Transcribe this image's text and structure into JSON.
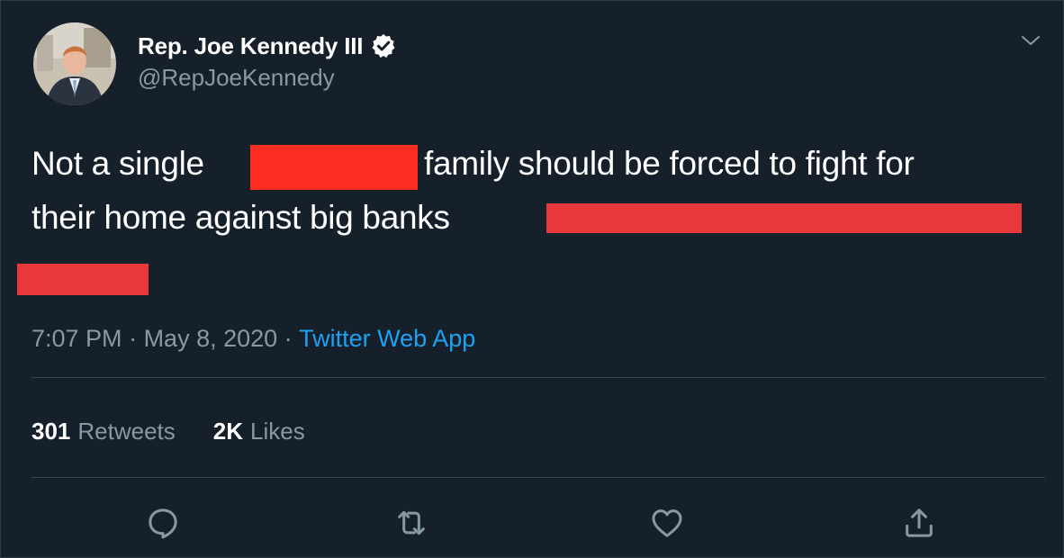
{
  "author": {
    "display_name": "Rep. Joe Kennedy III",
    "handle": "@RepJoeKennedy",
    "verified": true
  },
  "tweet": {
    "segment_1": "Not a single",
    "segment_2": "family should be forced to fight for",
    "segment_3": "their home against big banks"
  },
  "meta": {
    "time": "7:07 PM",
    "sep1": " · ",
    "date": "May 8, 2020",
    "sep2": " · ",
    "source": "Twitter Web App"
  },
  "stats": {
    "retweets_count": "301",
    "retweets_label": "Retweets",
    "likes_count": "2K",
    "likes_label": "Likes"
  },
  "actions": [
    "reply",
    "retweet",
    "like",
    "share"
  ],
  "colors": {
    "background": "#16202a",
    "secondary_text": "#8899a6",
    "link": "#1da1f2",
    "redaction": "#f02a22"
  }
}
